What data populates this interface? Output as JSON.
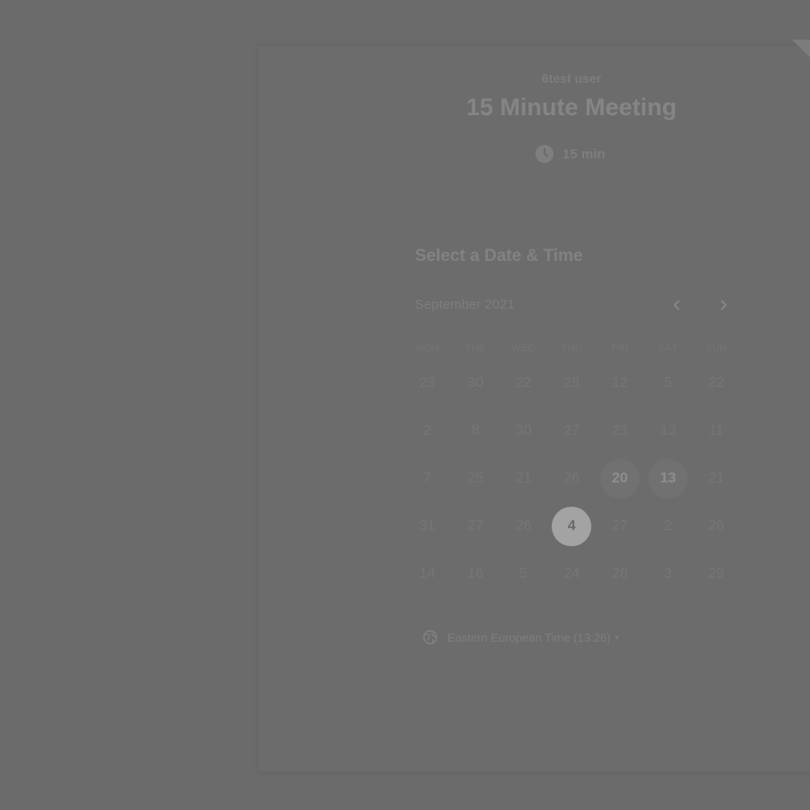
{
  "event": {
    "host": "6test user",
    "title": "15 Minute Meeting",
    "duration": "15 min"
  },
  "scheduler": {
    "heading": "Select a Date & Time",
    "month": "September 2021",
    "weekdays": [
      "MON",
      "TUE",
      "WED",
      "THU",
      "FRI",
      "SAT",
      "SUN"
    ],
    "weeks": [
      [
        "23",
        "30",
        "22",
        "28",
        "12",
        "5",
        "22"
      ],
      [
        "2",
        "8",
        "30",
        "27",
        "23",
        "13",
        "11"
      ],
      [
        "7",
        "25",
        "21",
        "26",
        "20",
        "13",
        "21"
      ],
      [
        "31",
        "27",
        "26",
        "4",
        "27",
        "2",
        "26"
      ],
      [
        "14",
        "16",
        "5",
        "24",
        "28",
        "3",
        "29"
      ]
    ],
    "available_dates": [
      [
        2,
        4
      ],
      [
        2,
        5
      ]
    ],
    "selected_date": [
      3,
      3
    ]
  },
  "timezone": {
    "label": "Eastern European Time (13:26)",
    "caret": "▾"
  },
  "icons": {
    "duration": "clock-icon",
    "prev": "chevron-left-icon",
    "next": "chevron-right-icon",
    "timezone": "globe-icon"
  }
}
